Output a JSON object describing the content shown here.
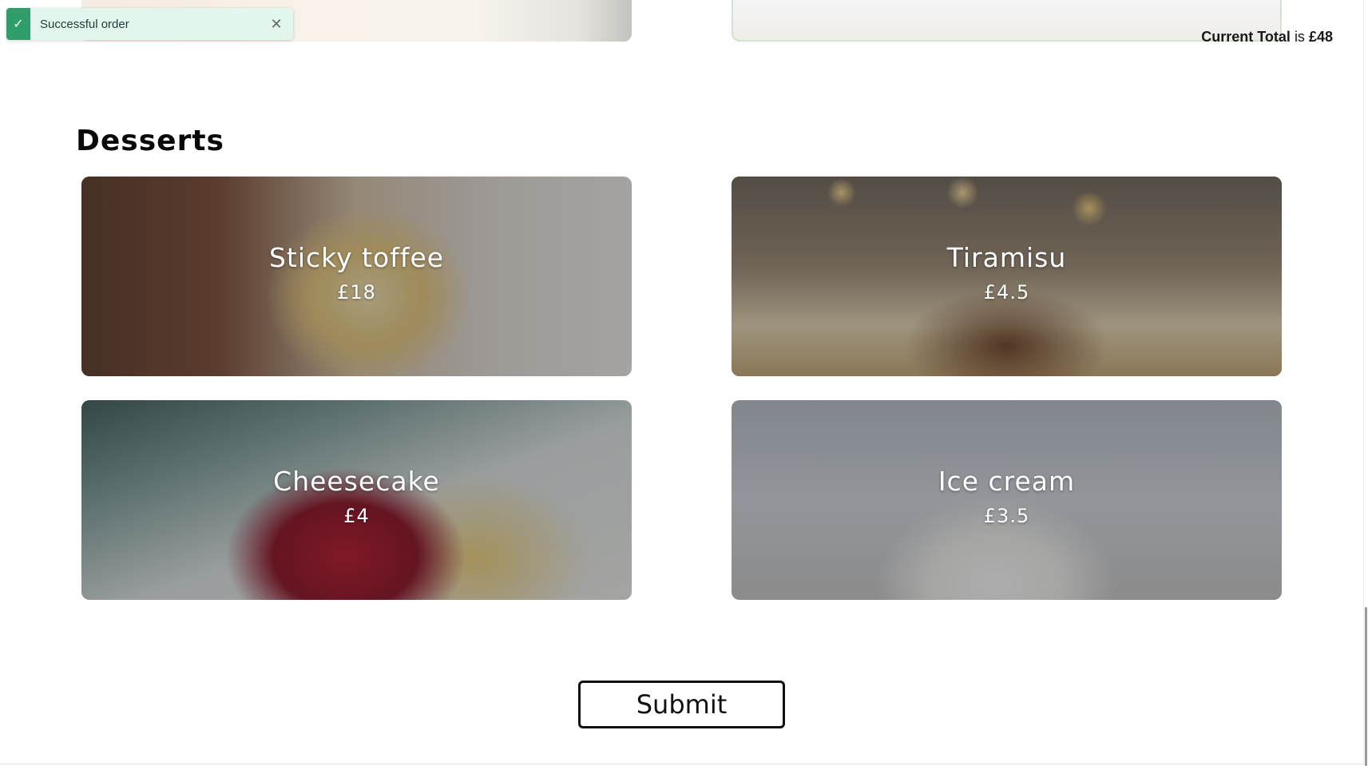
{
  "toast": {
    "message": "Successful order",
    "check_icon": "✓",
    "close_icon": "✕",
    "color": "#2f9e6a"
  },
  "order": {
    "total_label": "Current Total",
    "total_connector": "is",
    "total_value": "£48"
  },
  "section": {
    "title": "Desserts"
  },
  "desserts": [
    {
      "name": "Sticky toffee",
      "price": "£18",
      "selected": false
    },
    {
      "name": "Tiramisu",
      "price": "£4.5",
      "selected": true
    },
    {
      "name": "Cheesecake",
      "price": "£4",
      "selected": false
    },
    {
      "name": "Ice cream",
      "price": "£3.5",
      "selected": false
    }
  ],
  "submit": {
    "label": "Submit"
  },
  "colors": {
    "selected_border": "#1a8a2a"
  }
}
